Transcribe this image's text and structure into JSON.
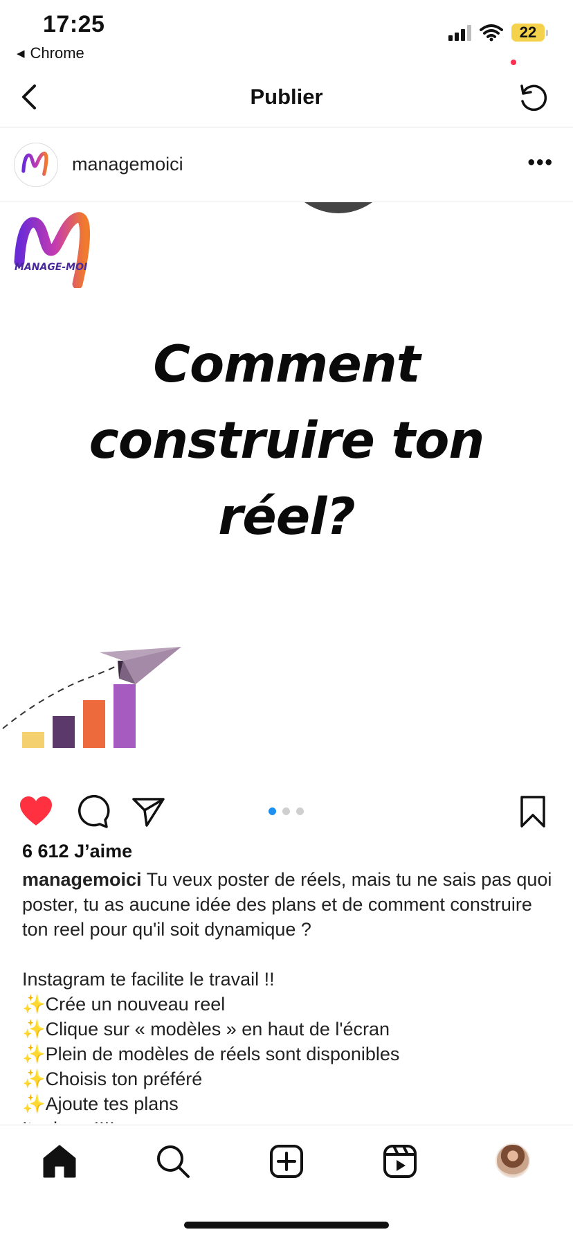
{
  "status_bar": {
    "time": "17:25",
    "back_app": "Chrome",
    "battery": "22",
    "battery_color": "#f5d24b"
  },
  "nav": {
    "title": "Publier",
    "back_icon": "chevron-left-icon",
    "refresh_icon": "refresh-icon"
  },
  "post": {
    "username": "managemoici",
    "logo_text": "MANAGE-MOI",
    "headline_lines": [
      "Comment",
      "construire ton",
      "réel?"
    ],
    "carousel": {
      "count": 3,
      "active": 0
    },
    "growth_bars": [
      {
        "value": 1,
        "color": "#f4d06f"
      },
      {
        "value": 2,
        "color": "#5b3a6b"
      },
      {
        "value": 3,
        "color": "#ec6a3c"
      },
      {
        "value": 4,
        "color": "#a55bbf"
      }
    ],
    "likes": "6 612 J’aime",
    "liked": true,
    "like_color": "#ff3040",
    "caption": {
      "user": "managemoici",
      "intro": "Tu veux poster de réels, mais tu ne sais pas quoi poster, tu as aucune idée des plans et de comment construire ton reel pour qu'il soit dynamique ?",
      "line1": "Instagram te facilite le travail !!",
      "sparkle": "✨",
      "steps": [
        "Crée un nouveau reel",
        "Clique sur « modèles » en haut de l'écran",
        "Plein de modèles de réels sont disponibles",
        "Choisis ton préféré",
        "Ajoute tes plans"
      ],
      "last": "Its done !!!!"
    }
  },
  "tabbar": {
    "tabs": [
      "home-icon",
      "search-icon",
      "create-icon",
      "reels-icon",
      "profile-avatar"
    ]
  }
}
